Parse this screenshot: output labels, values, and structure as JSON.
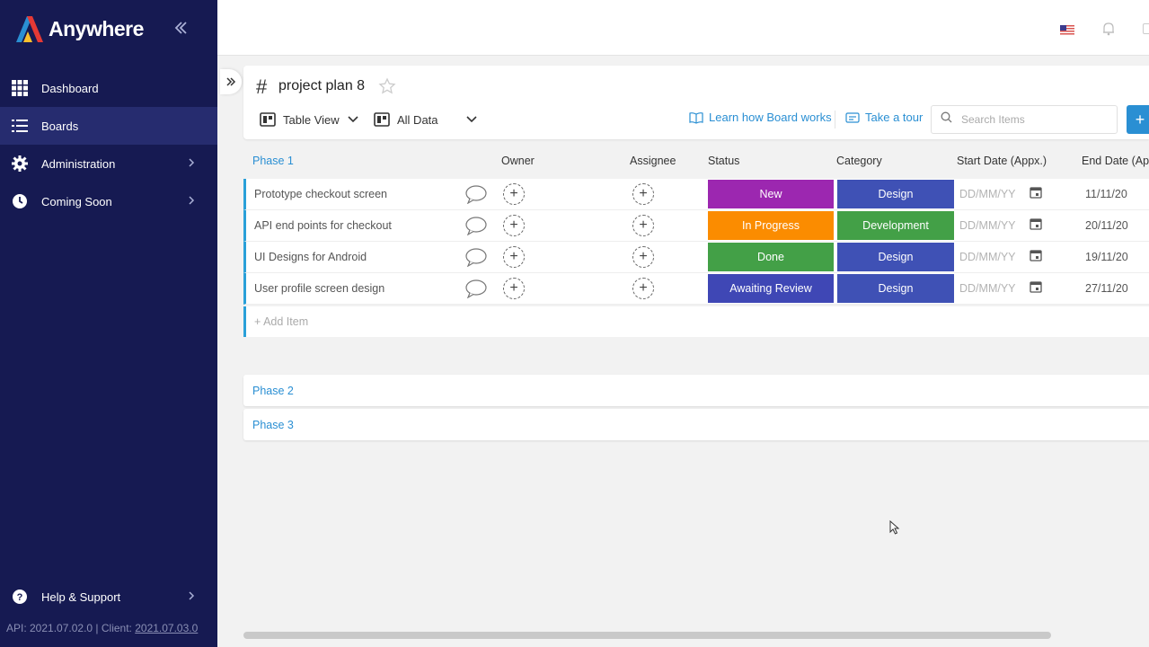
{
  "brand": {
    "name": "Anywhere"
  },
  "sidebar": {
    "items": [
      {
        "label": "Dashboard",
        "icon": "grid-icon"
      },
      {
        "label": "Boards",
        "icon": "list-icon",
        "active": true
      },
      {
        "label": "Administration",
        "icon": "gear-icon",
        "chevron": true
      },
      {
        "label": "Coming Soon",
        "icon": "clock-icon",
        "chevron": true
      }
    ],
    "help": {
      "label": "Help & Support",
      "icon": "help-icon"
    },
    "version": {
      "api_prefix": "API: 2021.07.02.0 | Client: ",
      "client": "2021.07.03.0"
    }
  },
  "board": {
    "hash": "#",
    "title": "project plan 8",
    "view_label": "Table View",
    "filter_label": "All Data",
    "learn_label": "Learn how Board works",
    "tour_label": "Take a tour",
    "search_placeholder": "Search Items",
    "add_label": "+"
  },
  "table": {
    "group": "Phase 1",
    "columns": {
      "owner": "Owner",
      "assignee": "Assignee",
      "status": "Status",
      "category": "Category",
      "start": "Start Date (Appx.)",
      "end": "End Date (Appx.)"
    },
    "date_placeholder": "DD/MM/YY",
    "add_item": "+ Add Item",
    "rows": [
      {
        "name": "Prototype checkout screen",
        "status": "New",
        "category": "Design",
        "end": "11/11/20"
      },
      {
        "name": "API end points for checkout",
        "status": "In Progress",
        "category": "Development",
        "end": "20/11/20"
      },
      {
        "name": "UI Designs for Android",
        "status": "Done",
        "category": "Design",
        "end": "19/11/20"
      },
      {
        "name": "User profile screen design",
        "status": "Awaiting Review",
        "category": "Design",
        "end": "27/11/20"
      }
    ]
  },
  "colors": {
    "sidebar": "#161a52",
    "accent": "#2a8fd3",
    "status_new": "#9c27b0",
    "status_in_progress": "#fb8c00",
    "status_done": "#43a047",
    "status_awaiting": "#3f47b5",
    "cat_design": "#3f51b5",
    "cat_development": "#43a047"
  },
  "phases": [
    {
      "label": "Phase 2"
    },
    {
      "label": "Phase 3"
    }
  ]
}
